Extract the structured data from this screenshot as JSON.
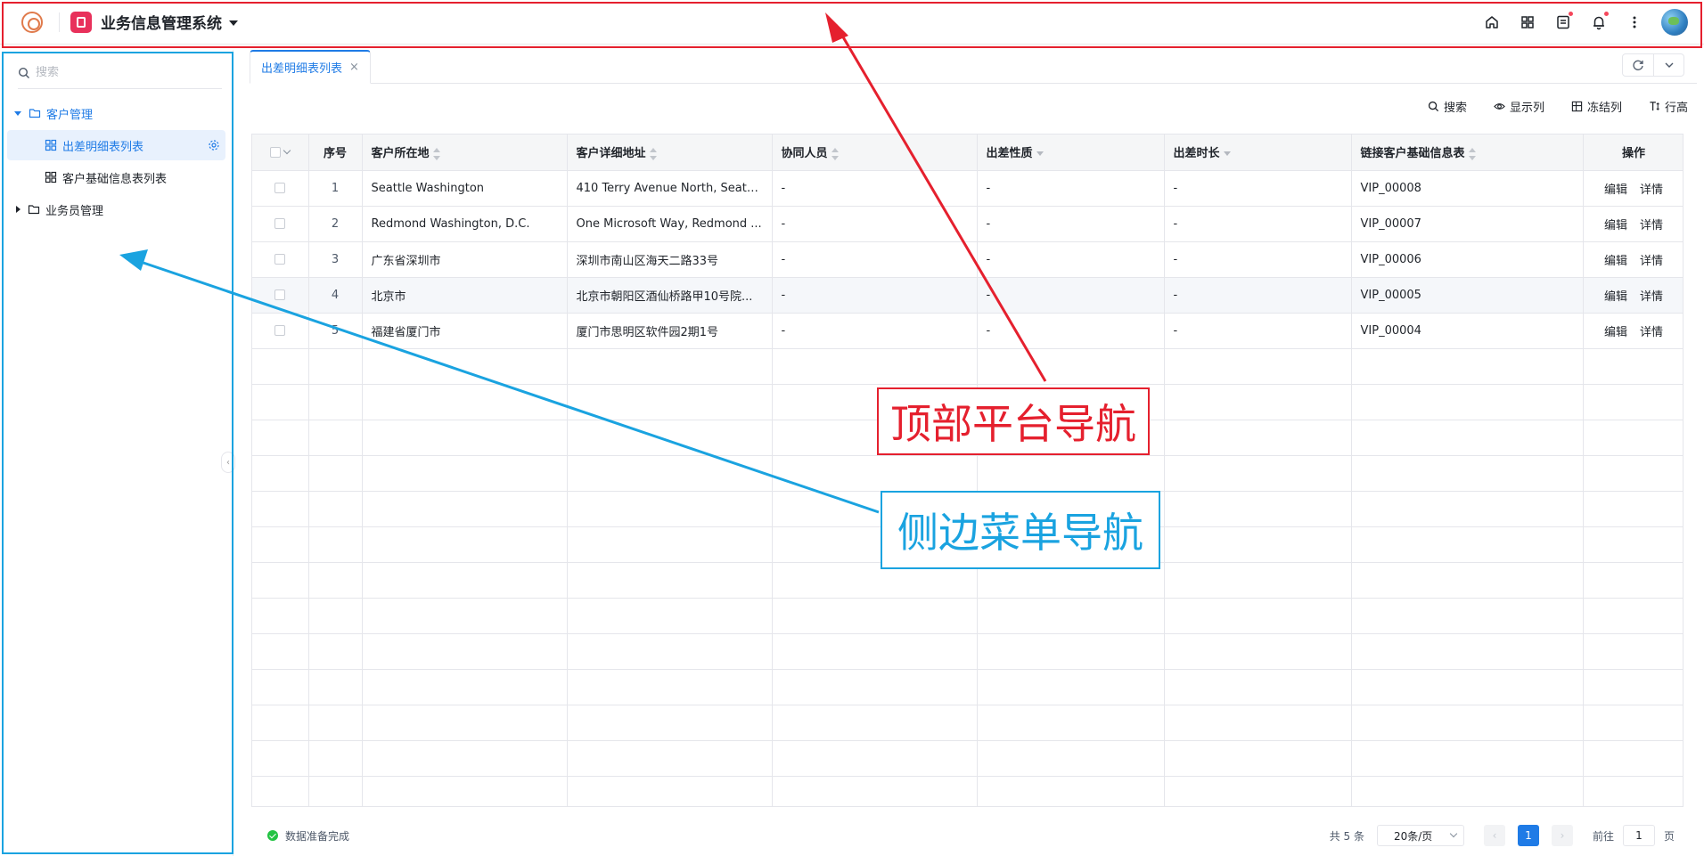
{
  "header": {
    "app_title": "业务信息管理系统",
    "icons": [
      "home-icon",
      "apps-grid-icon",
      "document-icon",
      "bell-icon",
      "more-vertical-icon"
    ]
  },
  "sidebar": {
    "search_placeholder": "搜索",
    "groups": [
      {
        "label": "客户管理",
        "expanded": true,
        "items": [
          {
            "label": "出差明细表列表",
            "active": true
          },
          {
            "label": "客户基础信息表列表",
            "active": false
          }
        ]
      },
      {
        "label": "业务员管理",
        "expanded": false,
        "items": []
      }
    ]
  },
  "tabs": [
    {
      "label": "出差明细表列表",
      "close": "×"
    }
  ],
  "toolbar": {
    "search": "搜索",
    "columns": "显示列",
    "freeze": "冻结列",
    "row_height": "行高"
  },
  "table": {
    "headers": {
      "index": "序号",
      "location": "客户所在地",
      "address": "客户详细地址",
      "companions": "协同人员",
      "nature": "出差性质",
      "duration": "出差时长",
      "link": "链接客户基础信息表",
      "ops": "操作"
    },
    "rows": [
      {
        "index": "1",
        "location": "Seattle Washington",
        "address": "410 Terry Avenue North, Seattle...",
        "companions": "-",
        "nature": "-",
        "duration": "-",
        "link": "VIP_00008"
      },
      {
        "index": "2",
        "location": "Redmond Washington, D.C.",
        "address": "One Microsoft Way, Redmond ...",
        "companions": "-",
        "nature": "-",
        "duration": "-",
        "link": "VIP_00007"
      },
      {
        "index": "3",
        "location": "广东省深圳市",
        "address": "深圳市南山区海天二路33号",
        "companions": "-",
        "nature": "-",
        "duration": "-",
        "link": "VIP_00006"
      },
      {
        "index": "4",
        "location": "北京市",
        "address": "北京市朝阳区酒仙桥路甲10号院...",
        "companions": "-",
        "nature": "-",
        "duration": "-",
        "link": "VIP_00005"
      },
      {
        "index": "5",
        "location": "福建省厦门市",
        "address": "厦门市思明区软件园2期1号",
        "companions": "-",
        "nature": "-",
        "duration": "-",
        "link": "VIP_00004"
      }
    ],
    "edit_label": "编辑",
    "detail_label": "详情"
  },
  "footer": {
    "status": "数据准备完成",
    "total": "共 5 条",
    "page_size": "20条/页",
    "current_page": "1",
    "goto_label": "前往",
    "goto_value": "1",
    "page_unit": "页"
  },
  "annotations": {
    "top_label": "顶部平台导航",
    "side_label": "侧边菜单导航",
    "top_color": "#e5202e",
    "side_color": "#1aa3e0"
  },
  "colors": {
    "accent": "#1f7be6",
    "app_icon": "#e8315b"
  }
}
